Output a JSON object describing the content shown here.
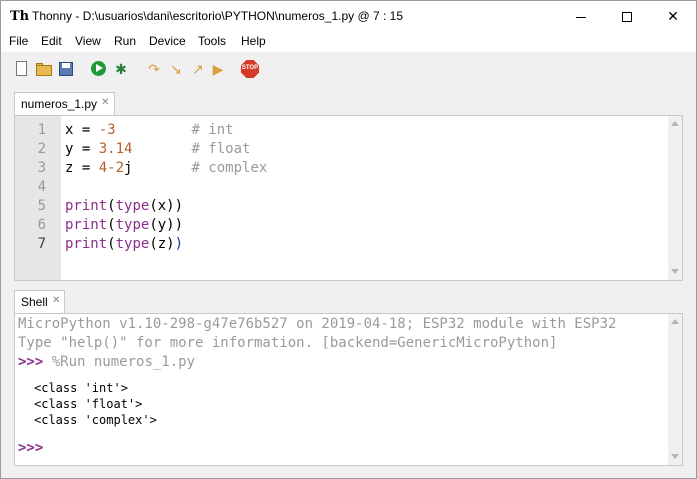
{
  "window": {
    "app_icon_glyph": "Th",
    "title": "Thonny  -  D:\\usuarios\\dani\\escritorio\\PYTHON\\numeros_1.py  @  7 : 15",
    "minimize_icon": "minimize-icon",
    "maximize_icon": "maximize-icon",
    "close_glyph": "✕"
  },
  "menu": {
    "items": [
      "File",
      "Edit",
      "View",
      "Run",
      "Device",
      "Tools",
      "Help"
    ]
  },
  "toolbar": {
    "stop_text": "STOP",
    "debug_glyph": "✱",
    "step_over_glyph": "↷",
    "step_into_glyph": "↘",
    "step_out_glyph": "↗",
    "resume_glyph": "▶"
  },
  "editor": {
    "tab_label": "numeros_1.py",
    "tab_close": "✕",
    "line_numbers": [
      "1",
      "2",
      "3",
      "4",
      "5",
      "6",
      "7"
    ],
    "lines": [
      {
        "pre": "x = ",
        "num": "-3",
        "mid": "         ",
        "cmt": "# int"
      },
      {
        "pre": "y = ",
        "num": "3.14",
        "mid": "       ",
        "cmt": "# float"
      },
      {
        "pre": "z = ",
        "num": "4-2",
        "post": "j",
        "mid": "       ",
        "cmt": "# complex"
      },
      {},
      {
        "fn": "print",
        "a": "(",
        "fn2": "type",
        "b": "(x))"
      },
      {
        "fn": "print",
        "a": "(",
        "fn2": "type",
        "b": "(y))"
      },
      {
        "fn": "print",
        "a": "(",
        "fn2": "type",
        "b": "(z)",
        "c": ")"
      }
    ]
  },
  "shell": {
    "tab_label": "Shell",
    "tab_close": "✕",
    "banner_line1": "MicroPython v1.10-298-g47e76b527 on 2019-04-18; ESP32 module with ESP32",
    "banner_line2": "Type \"help()\" for more information. [backend=GenericMicroPython]",
    "prompt": ">>>",
    "run_command": " %Run numeros_1.py",
    "output": [
      "<class 'int'>",
      "<class 'float'>",
      "<class 'complex'>"
    ],
    "final_prompt": ">>>"
  },
  "colors": {
    "number": "#b5612d",
    "comment": "#9a9a9a",
    "builtin": "#8b2f8b",
    "prompt": "#8b2f8b"
  }
}
